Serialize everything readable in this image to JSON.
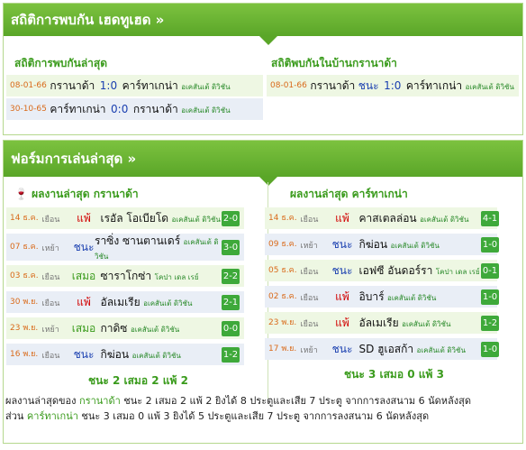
{
  "h2h_header": "สถิติการพบกัน เฮดทูเฮด »",
  "h2h": {
    "latest_title": "สถิติการพบกันล่าสุด",
    "home_title": "สถิติพบกันในบ้านกรานาด้า",
    "latest": [
      {
        "date": "08-01-66",
        "home": "กรานาด้า",
        "score": "1:0",
        "away": "คาร์ทาเกน่า",
        "league": "อเคสันเต้ ดิวิชัน"
      },
      {
        "date": "30-10-65",
        "home": "คาร์ทาเกน่า",
        "score": "0:0",
        "away": "กรานาด้า",
        "league": "อเคสันเต้ ดิวิชัน"
      }
    ],
    "home": [
      {
        "date": "08-01-66",
        "home": "กรานาด้า",
        "result": "ชนะ",
        "score": "1:0",
        "away": "คาร์ทาเกน่า",
        "league": "อเคสันเต้ ดิวิชัน"
      }
    ]
  },
  "form_header": "ฟอร์มการเล่นล่าสุด »",
  "form": {
    "left_title": "ผลงานล่าสุด กรานาด้า",
    "right_title": "ผลงานล่าสุด คาร์ทาเกน่า",
    "left": [
      {
        "date": "14 ธ.ค.",
        "ha": "เยือน",
        "result": "แพ้",
        "opp": "เรอัล โอเบียโด",
        "league": "อเคสันเต้ ดิวิชัน",
        "score": "2-0"
      },
      {
        "date": "07 ธ.ค.",
        "ha": "เหย้า",
        "result": "ชนะ",
        "opp": "ราซิ่ง ซานตานเดร์",
        "league": "อเคสันเต้ ดิวิชัน",
        "score": "3-0"
      },
      {
        "date": "03 ธ.ค.",
        "ha": "เยือน",
        "result": "เสมอ",
        "opp": "ซาราโกซ่า",
        "league": "โคปา เดล เรย์",
        "score": "2-2"
      },
      {
        "date": "30 พ.ย.",
        "ha": "เยือน",
        "result": "แพ้",
        "opp": "อัลเมเรีย",
        "league": "อเคสันเต้ ดิวิชัน",
        "score": "2-1"
      },
      {
        "date": "23 พ.ย.",
        "ha": "เหย้า",
        "result": "เสมอ",
        "opp": "กาดิซ",
        "league": "อเคสันเต้ ดิวิชัน",
        "score": "0-0"
      },
      {
        "date": "16 พ.ย.",
        "ha": "เยือน",
        "result": "ชนะ",
        "opp": "กิฆ่อน",
        "league": "อเคสันเต้ ดิวิชัน",
        "score": "1-2"
      }
    ],
    "right": [
      {
        "date": "14 ธ.ค.",
        "ha": "เยือน",
        "result": "แพ้",
        "opp": "คาสเตลล่อน",
        "league": "อเคสันเต้ ดิวิชัน",
        "score": "4-1"
      },
      {
        "date": "09 ธ.ค.",
        "ha": "เหย้า",
        "result": "ชนะ",
        "opp": "กิฆ่อน",
        "league": "อเคสันเต้ ดิวิชัน",
        "score": "1-0"
      },
      {
        "date": "05 ธ.ค.",
        "ha": "เยือน",
        "result": "ชนะ",
        "opp": "เอฟซี อันดอร์รา",
        "league": "โคปา เดล เรย์",
        "score": "0-1"
      },
      {
        "date": "02 ธ.ค.",
        "ha": "เยือน",
        "result": "แพ้",
        "opp": "อิบาร์",
        "league": "อเคสันเต้ ดิวิชัน",
        "score": "1-0"
      },
      {
        "date": "23 พ.ย.",
        "ha": "เยือน",
        "result": "แพ้",
        "opp": "อัลเมเรีย",
        "league": "อเคสันเต้ ดิวิชัน",
        "score": "1-2"
      },
      {
        "date": "17 พ.ย.",
        "ha": "เหย้า",
        "result": "ชนะ",
        "opp": "SD ฮูเอสก้า",
        "league": "อเคสันเต้ ดิวิชัน",
        "score": "1-0"
      }
    ],
    "left_summary": "ชนะ 2 เสมอ 2 แพ้ 2",
    "right_summary": "ชนะ 3 เสมอ 0 แพ้ 3"
  },
  "bottom": {
    "l1_a": "ผลงานล่าสุดของ ",
    "l1_team": "กรานาด้า",
    "l1_b": " ชนะ 2 เสมอ 2 แพ้ 2 ยิงได้ 8 ประตูและเสีย 7 ประตู จากการลงสนาม 6 นัดหลังสุด",
    "l2_a": "ส่วน ",
    "l2_team": "คาร์ทาเกน่า",
    "l2_b": " ชนะ 3 เสมอ 0 แพ้ 3 ยิงได้ 5 ประตูและเสีย 7 ประตู จากการลงสนาม 6 นัดหลังสุด"
  },
  "colors": {
    "accent": "#5aa628",
    "win": "#1a3fb0",
    "loss": "#d10000",
    "draw": "#3a9b1c",
    "badge": "#3ea93a"
  }
}
